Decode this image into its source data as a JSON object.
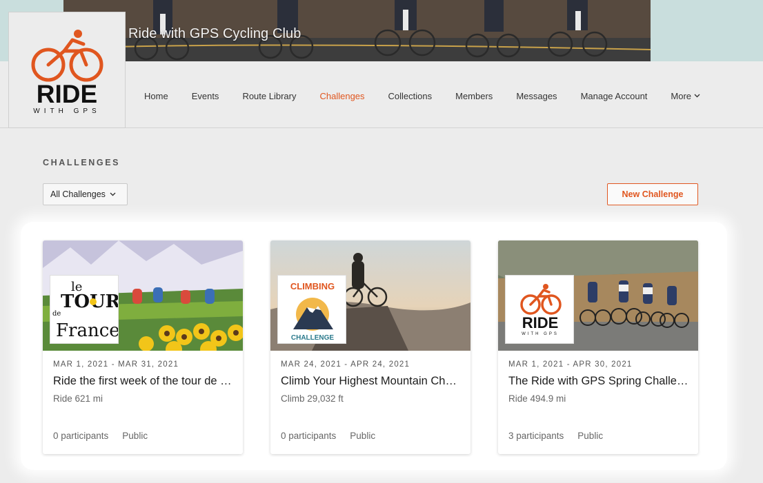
{
  "club": {
    "title": "Ride with GPS Cycling Club"
  },
  "logo": {
    "word": "RIDE",
    "sub": "WITH GPS",
    "icon": "cyclist-logo-icon"
  },
  "nav": {
    "items": [
      {
        "label": "Home"
      },
      {
        "label": "Events"
      },
      {
        "label": "Route Library"
      },
      {
        "label": "Challenges",
        "active": true
      },
      {
        "label": "Collections"
      },
      {
        "label": "Members"
      },
      {
        "label": "Messages"
      },
      {
        "label": "Manage Account"
      }
    ],
    "more_label": "More"
  },
  "challenges": {
    "section_title": "CHALLENGES",
    "filter": {
      "selected": "All Challenges"
    },
    "new_button": "New Challenge",
    "cards": [
      {
        "date_range": "MAR 1, 2021 - MAR 31, 2021",
        "title": "Ride the first week of the tour de France",
        "goal": "Ride 621 mi",
        "participants": "0 participants",
        "visibility": "Public",
        "logo_text": [
          "le",
          "TOUR",
          "de",
          "France"
        ]
      },
      {
        "date_range": "MAR 24, 2021 - APR 24, 2021",
        "title": "Climb Your Highest Mountain Challenge",
        "goal": "Climb 29,032 ft",
        "participants": "0 participants",
        "visibility": "Public",
        "logo_text": [
          "CLIMBING",
          "CHALLENGE"
        ]
      },
      {
        "date_range": "MAR 1, 2021 - APR 30, 2021",
        "title": "The Ride with GPS Spring Challenge",
        "goal": "Ride 494.9 mi",
        "participants": "3 participants",
        "visibility": "Public",
        "logo_text": [
          "RIDE",
          "WITH GPS"
        ]
      }
    ]
  },
  "colors": {
    "accent": "#e0561f",
    "header_band": "#c9dedd",
    "background": "#ececec"
  }
}
